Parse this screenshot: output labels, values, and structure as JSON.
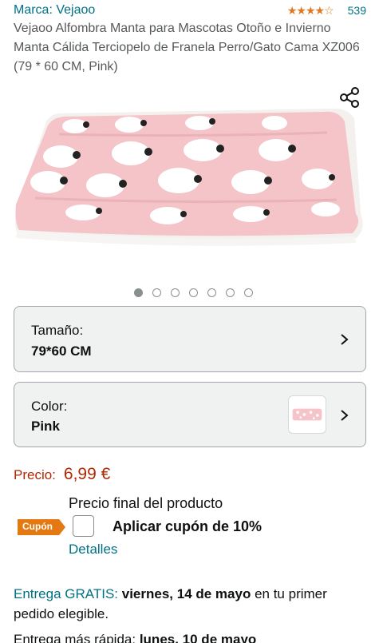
{
  "product": {
    "brand_label": "Marca: Vejaoo",
    "rating_stars": "★★★★☆",
    "rating_count": "539",
    "title": "Vejaoo Alfombra Manta para Mascotas Otoño e Invierno Manta Cálida Terciopelo de Franela Perro/Gato Cama XZ006 (79 * 60 CM, Pink)",
    "rating_fraction": 0.9
  },
  "gallery": {
    "image_count": 7,
    "active_index": 0,
    "image_icon": "pink-pet-blanket-image"
  },
  "variants": {
    "size_label": "Tamaño:",
    "size_value": "79*60 CM",
    "color_label": "Color:",
    "color_value": "Pink"
  },
  "price": {
    "label": "Precio:",
    "value": "6,99 €",
    "final_text": "Precio final del producto"
  },
  "coupon": {
    "badge": "Cupón",
    "text": "Aplicar cupón de 10%",
    "details": "Detalles",
    "checked": false
  },
  "delivery": {
    "free_label": "Entrega GRATIS:",
    "date": "viernes, 14 de mayo",
    "suffix": "en tu primer pedido elegible.",
    "fast_label": "Entrega más rápida:",
    "fast_date": "lunes, 10 de mayo"
  },
  "colors": {
    "link": "#007185",
    "price": "#b12704",
    "star": "#de7921",
    "coupon_badge": "#e47911"
  }
}
